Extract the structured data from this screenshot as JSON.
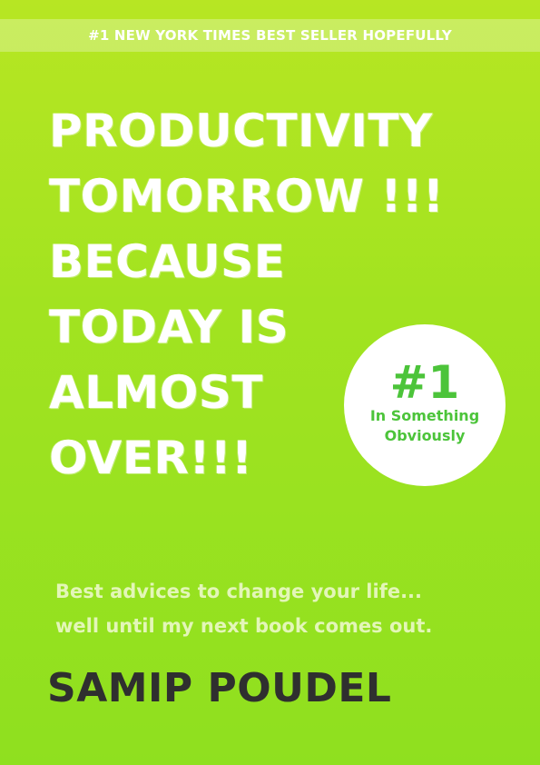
{
  "banner": {
    "text": "#1 NEW YORK TIMES BEST SELLER HOPEFULLY"
  },
  "title": {
    "lines": [
      "PRODUCTIVITY",
      "TOMORROW !!!",
      "BECAUSE",
      "TODAY IS",
      "ALMOST",
      "OVER!!!"
    ]
  },
  "badge": {
    "rank": "#1",
    "line1": "In Something",
    "line2": "Obviously"
  },
  "subtitle": {
    "line1": "Best advices to change your life...",
    "line2": "well until my next book comes out."
  },
  "author": {
    "name": "SAMIP POUDEL"
  },
  "colors": {
    "background_top": "#b7e623",
    "background_bottom": "#8fe01f",
    "badge_text": "#4cc43a",
    "author_text": "#2f2f2f",
    "subtitle_text": "#e3f6b8"
  }
}
